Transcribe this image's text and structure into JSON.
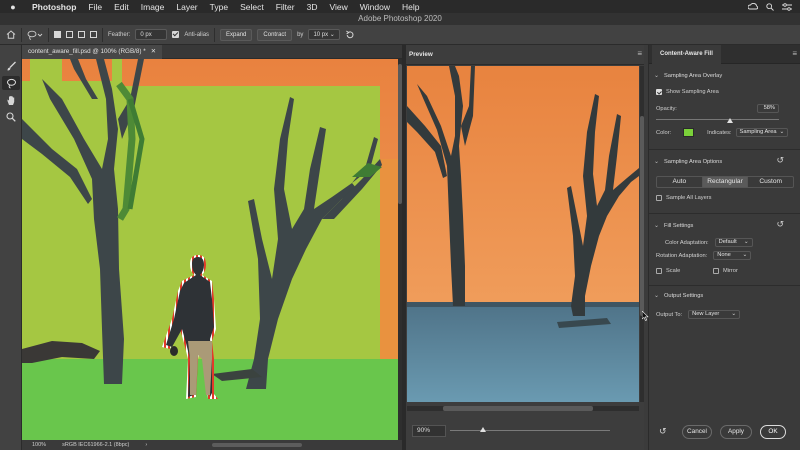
{
  "menubar": {
    "app_name": "Photoshop",
    "items": [
      "File",
      "Edit",
      "Image",
      "Layer",
      "Type",
      "Select",
      "Filter",
      "3D",
      "View",
      "Window",
      "Help"
    ]
  },
  "window": {
    "title": "Adobe Photoshop 2020"
  },
  "options_bar": {
    "feather_label": "Feather:",
    "feather_value": "0 px",
    "anti_alias_label": "Anti-alias",
    "expand_label": "Expand",
    "contract_label": "Contract",
    "by_label": "by",
    "by_value": "10 px"
  },
  "document": {
    "tab_title": "content_aware_fill.psd @ 100% (RGB/8) *",
    "zoom": "100%",
    "color_profile": "sRGB IEC61966-2.1 (8bpc)"
  },
  "preview": {
    "title": "Preview",
    "zoom": "90%"
  },
  "panel": {
    "title": "Content-Aware Fill",
    "sampling_overlay": {
      "header": "Sampling Area Overlay",
      "show_sampling_label": "Show Sampling Area",
      "opacity_label": "Opacity:",
      "opacity_value": "58%",
      "color_label": "Color:",
      "indicates_label": "Indicates:",
      "indicates_value": "Sampling Area",
      "overlay_color": "#7bd13a"
    },
    "sampling_options": {
      "header": "Sampling Area Options",
      "buttons": [
        "Auto",
        "Rectangular",
        "Custom"
      ],
      "selected": "Rectangular",
      "sample_all_layers_label": "Sample All Layers"
    },
    "fill_settings": {
      "header": "Fill Settings",
      "color_adaptation_label": "Color Adaptation:",
      "color_adaptation_value": "Default",
      "rotation_adaptation_label": "Rotation Adaptation:",
      "rotation_adaptation_value": "None",
      "scale_label": "Scale",
      "mirror_label": "Mirror"
    },
    "output_settings": {
      "header": "Output Settings",
      "output_to_label": "Output To:",
      "output_to_value": "New Layer"
    },
    "buttons": {
      "cancel": "Cancel",
      "apply": "Apply",
      "ok": "OK"
    }
  }
}
